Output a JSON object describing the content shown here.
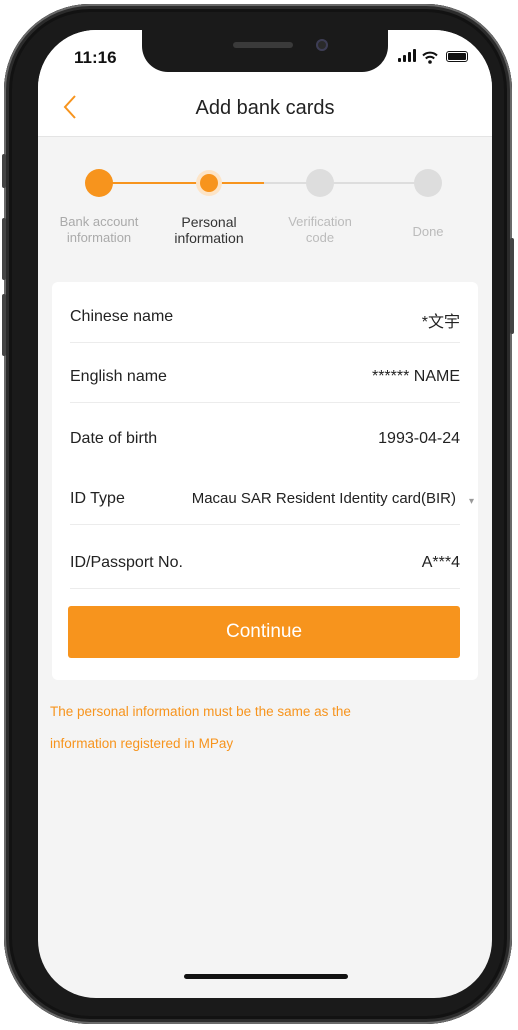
{
  "status_bar": {
    "time": "11:16"
  },
  "nav": {
    "title": "Add bank cards",
    "back_icon": "chevron-left-icon"
  },
  "stepper": {
    "steps": [
      {
        "label_line1": "Bank account",
        "label_line2": "information",
        "state": "done"
      },
      {
        "label_line1": "Personal",
        "label_line2": "information",
        "state": "current"
      },
      {
        "label_line1": "Verification",
        "label_line2": "code",
        "state": "pending"
      },
      {
        "label_line1": "Done",
        "label_line2": "",
        "state": "pending"
      }
    ]
  },
  "form": {
    "chinese_name": {
      "label": "Chinese name",
      "value": "*文宇"
    },
    "english_name": {
      "label": "English name",
      "value": "****** NAME"
    },
    "date_of_birth": {
      "label": "Date of birth",
      "value": "1993-04-24"
    },
    "id_type": {
      "label": "ID Type",
      "value": "Macau SAR Resident Identity card(BIR)"
    },
    "id_number": {
      "label": "ID/Passport No.",
      "value": "A***4"
    },
    "continue_label": "Continue"
  },
  "note": {
    "line1": "The personal information must be the same as the",
    "line2": "information registered in MPay"
  },
  "colors": {
    "accent": "#f7941d",
    "step_done": "#f7941d",
    "step_pending": "#dddddd",
    "label_done": "#aaaaaa",
    "label_current": "#333333",
    "label_pending": "#bbbbbb"
  }
}
